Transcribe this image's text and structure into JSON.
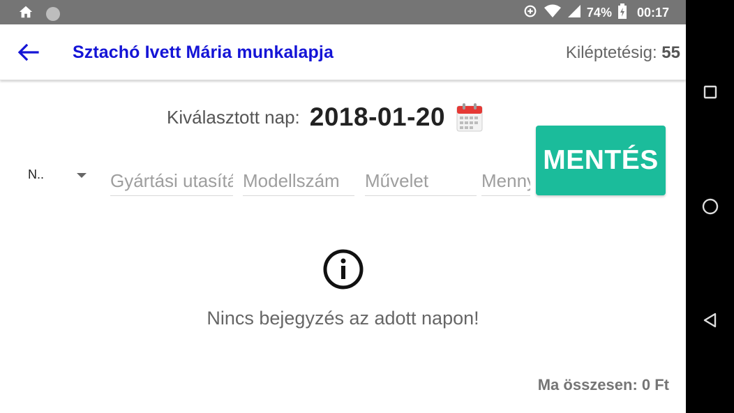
{
  "status_bar": {
    "battery": "74%",
    "time": "00:17",
    "icons": [
      "home-icon",
      "notification-dot-icon",
      "data-saver-icon",
      "wifi-icon",
      "signal-icon",
      "battery-icon"
    ]
  },
  "appbar": {
    "back_icon": "arrow-left-icon",
    "title": "Sztachó Ivett Mária munkalapja",
    "logout_label": "Kiléptetésig: ",
    "logout_value": "55"
  },
  "date": {
    "label": "Kiválasztott nap:",
    "value": "2018-01-20",
    "icon": "calendar-icon"
  },
  "form": {
    "select_value": "N..",
    "fields": [
      {
        "placeholder": "Gyártási utasítás",
        "value": ""
      },
      {
        "placeholder": "Modellszám",
        "value": ""
      },
      {
        "placeholder": "Művelet",
        "value": ""
      },
      {
        "placeholder": "Mennyiség",
        "value": ""
      }
    ]
  },
  "save_button": {
    "label": "MENTÉS"
  },
  "empty_state": {
    "icon": "info-icon",
    "message": "Nincs bejegyzés az adott napon!"
  },
  "footer": {
    "total": "Ma összesen: 0 Ft"
  },
  "colors": {
    "title": "#1414d6",
    "accent": "#1bbc9b",
    "status_bar": "#757575"
  },
  "nav_bar": {
    "icons": [
      "recents-square-icon",
      "home-circle-icon",
      "back-triangle-icon"
    ]
  }
}
